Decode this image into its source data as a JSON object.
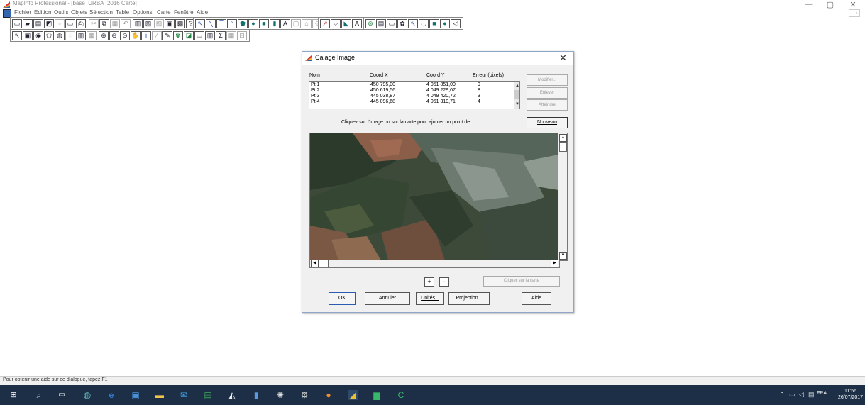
{
  "window": {
    "title": "MapInfo Professional - [base_URBA_2016 Carte]",
    "controls": {
      "minimize": "—",
      "maximize": "▢",
      "close": "✕"
    },
    "mdi_controls": "_ ▫"
  },
  "menu": [
    "Fichier",
    "Edition",
    "Outils",
    "Objets",
    "Sélection",
    "Table",
    "Options",
    "Carte",
    "Fenêtre",
    "Aide"
  ],
  "toolbar_icons": {
    "row1_a": [
      "new-icon",
      "open-icon",
      "open-workspace-icon",
      "save-icon",
      "save-as-icon",
      "close-icon",
      "print-icon"
    ],
    "row1_b": [
      "cut-icon",
      "copy-icon",
      "paste-icon",
      "undo-icon"
    ],
    "row1_c": [
      "new-browser-icon",
      "new-mapper-icon",
      "new-grapher-icon",
      "new-layout-icon",
      "new-redistrict-icon",
      "help-pointer-icon"
    ],
    "row1_d": [
      "select-icon",
      "line-icon",
      "polyline-icon",
      "arc-icon",
      "polygon-icon",
      "ellipse-icon",
      "rectangle-icon",
      "rounded-rect-icon",
      "text-icon",
      "frame-icon",
      "add-node-icon",
      "symbol-icon"
    ],
    "row1_e": [
      "line-style-icon",
      "region-style-icon",
      "polygon-style-icon",
      "text-style-icon"
    ],
    "row1_f": [
      "tool-a-icon",
      "tool-b-icon",
      "tool-c-icon",
      "tool-d-icon",
      "tool-e-icon",
      "tool-f-icon",
      "tool-g-icon",
      "tool-h-icon",
      "tool-i-icon"
    ],
    "row2_a": [
      "arrow-select-icon",
      "marquee-icon",
      "radius-icon",
      "polygon-select-icon",
      "boundary-icon",
      "unselect-icon",
      "invert-icon",
      "graph-select-icon"
    ],
    "row2_b": [
      "zoom-in-icon",
      "zoom-out-icon",
      "change-view-icon",
      "grabber-icon",
      "info-icon",
      "hotlink-icon",
      "label-icon",
      "drag-map-icon",
      "layer-control-icon",
      "ruler-icon",
      "legend-icon",
      "statistics-icon",
      "set-target-icon",
      "clip-region-icon"
    ]
  },
  "dialog": {
    "title": "Calage Image",
    "close_glyph": "✕",
    "columns": [
      "Nom",
      "Coord X",
      "Coord Y",
      "Erreur (pixels)"
    ],
    "points": [
      {
        "name": "Pt 1",
        "x": "450 795,00",
        "y": "4 051 851,00",
        "err": "9"
      },
      {
        "name": "Pt 2",
        "x": "450 619,56",
        "y": "4 049 229,07",
        "err": "8"
      },
      {
        "name": "Pt 3",
        "x": "445 038,87",
        "y": "4 049 420,72",
        "err": "3"
      },
      {
        "name": "Pt 4",
        "x": "445 096,68",
        "y": "4 051 319,71",
        "err": "4"
      }
    ],
    "side_buttons": {
      "modifier": "Modifier...",
      "enlever": "Enlever",
      "atteindre": "Atteindre",
      "nouveau": "Nouveau"
    },
    "hint": "Cliquez sur l'image ou sur la carte pour ajouter un point de",
    "zoom_in": "+",
    "zoom_out": "-",
    "clip_button": "Cliquer sur la carte",
    "buttons": {
      "ok": "OK",
      "annuler": "Annuler",
      "unites": "Unités...",
      "projection": "Projection...",
      "aide": "Aide"
    }
  },
  "statusbar": {
    "text": "Pour obtenir une aide sur ce dialogue, tapez F1"
  },
  "taskbar": {
    "apps": [
      "start-icon",
      "search-icon",
      "task-view-icon",
      "app-globe-icon",
      "edge-icon",
      "app-blue-icon",
      "file-explorer-icon",
      "mail-icon",
      "excel-icon",
      "photos-icon",
      "app-doc-icon",
      "app-network-icon",
      "app-gear-icon",
      "firefox-icon",
      "mapinfo-icon",
      "app-green-icon",
      "app-green-c-icon"
    ],
    "tray": {
      "lang": "FRA",
      "time": "11:56",
      "date": "26/07/2017"
    }
  },
  "colors": {
    "taskbar": "#1c2f47",
    "dialog_bg": "#f0f0f0",
    "accent": "#2a5bb0"
  }
}
